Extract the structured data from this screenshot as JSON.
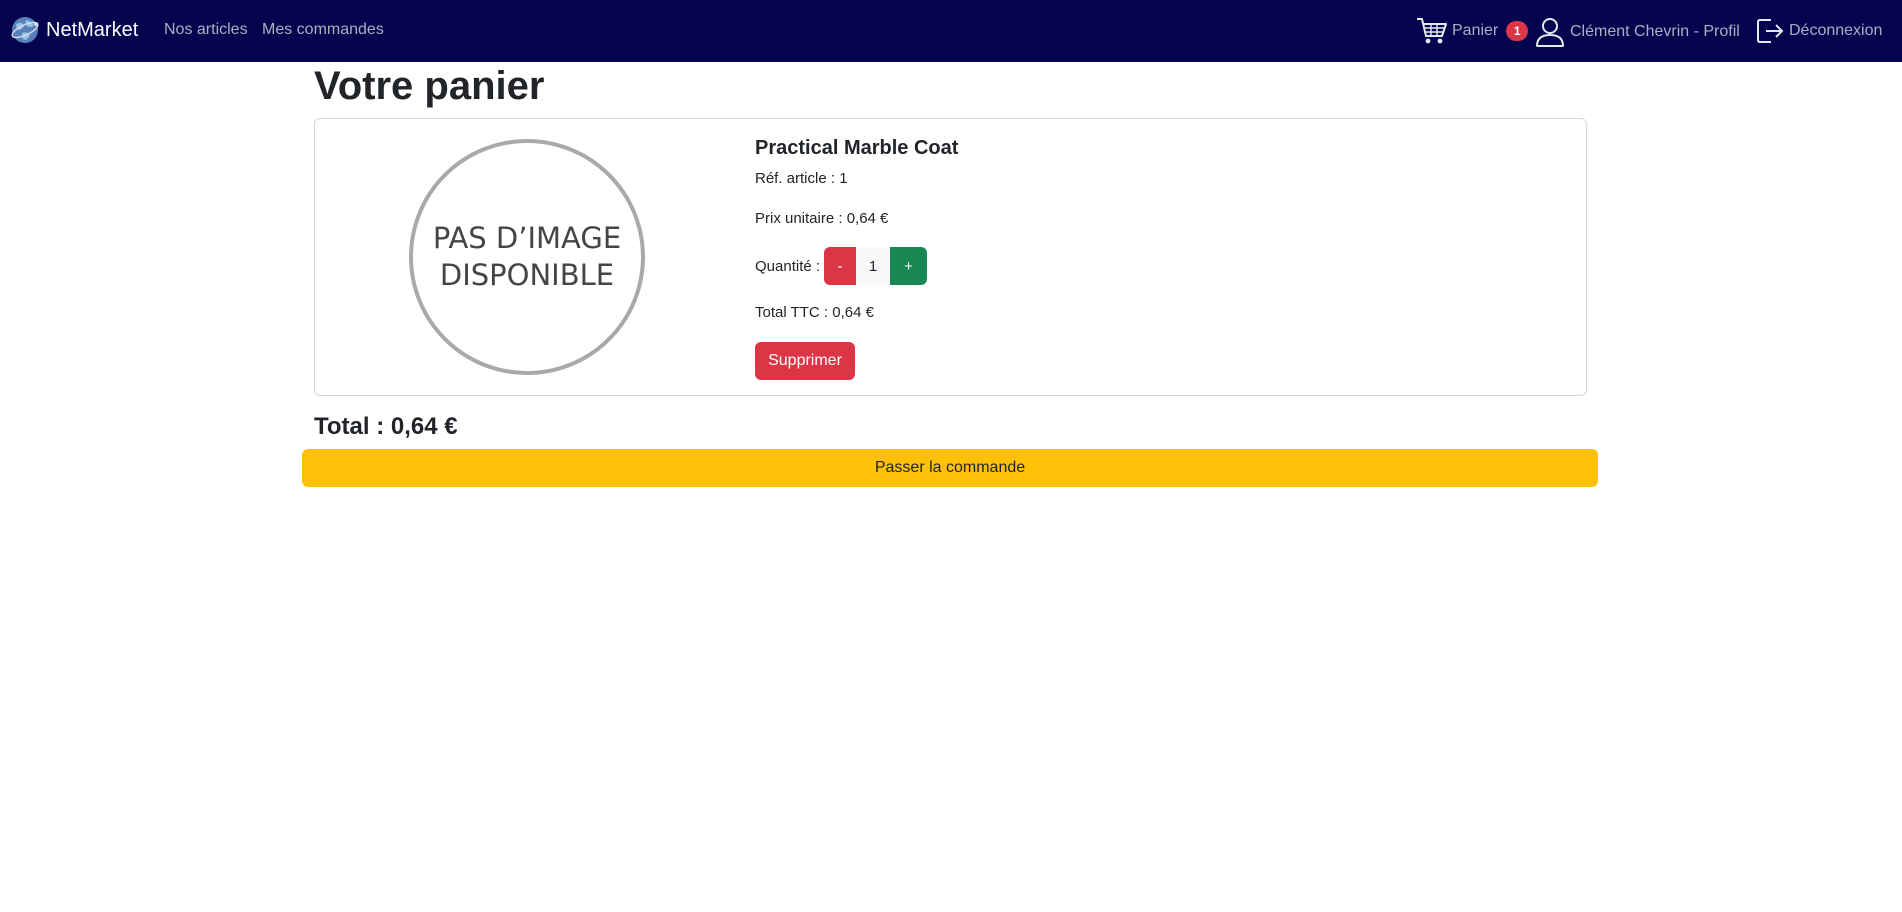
{
  "navbar": {
    "brand": {
      "name": "NetMarket",
      "icon": "globe-icon"
    },
    "links": [
      {
        "label": "Nos articles"
      },
      {
        "label": "Mes commandes"
      }
    ],
    "cart": {
      "label": "Panier",
      "count": "1",
      "icon": "cart-icon"
    },
    "profile": {
      "label": "Clément Chevrin - Profil",
      "icon": "user-icon"
    },
    "logout": {
      "label": "Déconnexion",
      "icon": "logout-icon"
    }
  },
  "page": {
    "title": "Votre panier"
  },
  "cart_items": [
    {
      "image_placeholder": {
        "line1": "PAS D’IMAGE",
        "line2": "DISPONIBLE"
      },
      "name": "Practical Marble Coat",
      "reference": "Réf. article : 1",
      "unit_price": "Prix unitaire : 0,64 €",
      "quantity_label": "Quantité :",
      "quantity": "1",
      "decrement_label": "-",
      "increment_label": "+",
      "total_ttc": "Total TTC : 0,64 €",
      "delete_label": "Supprimer"
    }
  ],
  "summary": {
    "total": "Total : 0,64 €",
    "checkout_label": "Passer la commande"
  },
  "colors": {
    "navbar_bg": "#03034e",
    "danger": "#dc3545",
    "success": "#198754",
    "warning": "#ffc107"
  }
}
